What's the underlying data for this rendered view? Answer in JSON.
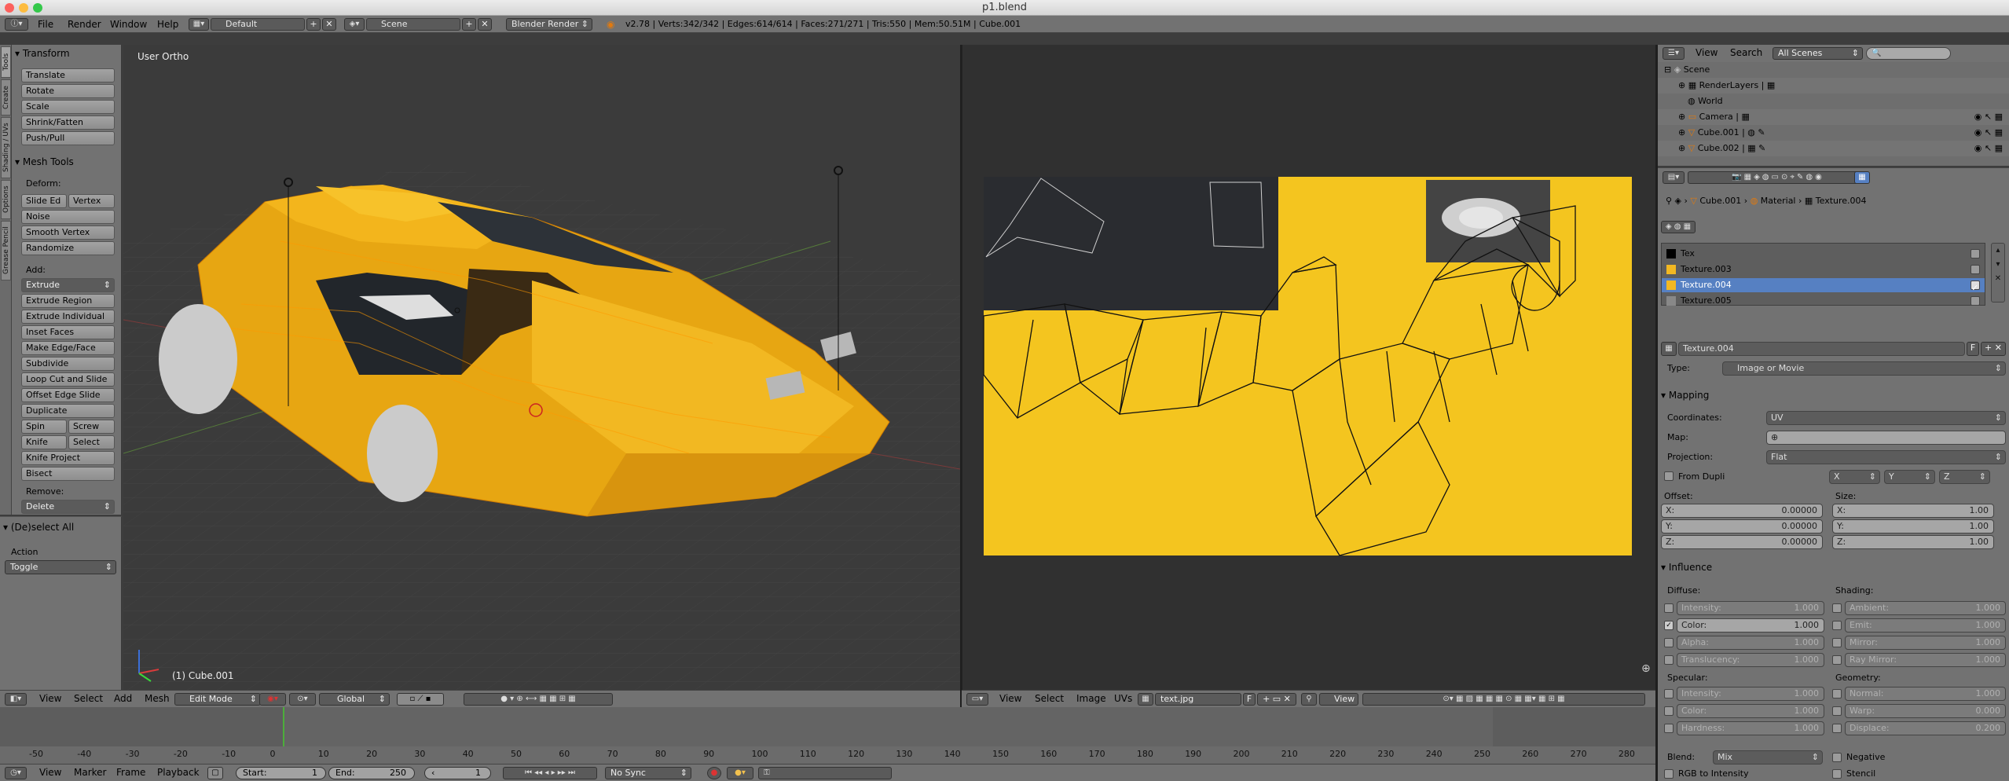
{
  "window": {
    "title": "p1.blend"
  },
  "infobar": {
    "menus": [
      "File",
      "Render",
      "Window",
      "Help"
    ],
    "layout": "Default",
    "scene": "Scene",
    "engine": "Blender Render",
    "stats": "v2.78 | Verts:342/342 | Edges:614/614 | Faces:271/271 | Tris:550 | Mem:50.51M | Cube.001"
  },
  "tool_tabs": [
    "Tools",
    "Create",
    "Shading / UVs",
    "Options",
    "Grease Pencil"
  ],
  "toolshelf": {
    "transform_header": "Transform",
    "transform": [
      "Translate",
      "Rotate",
      "Scale",
      "Shrink/Fatten",
      "Push/Pull"
    ],
    "mesh_tools_header": "Mesh Tools",
    "deform_label": "Deform:",
    "slide_edge": "Slide Ed",
    "vertex": "Vertex",
    "noise": "Noise",
    "smooth_vertex": "Smooth Vertex",
    "randomize": "Randomize",
    "add_label": "Add:",
    "extrude": "Extrude",
    "add_items": [
      "Extrude Region",
      "Extrude Individual",
      "Inset Faces",
      "Make Edge/Face",
      "Subdivide",
      "Loop Cut and Slide",
      "Offset Edge Slide",
      "Duplicate"
    ],
    "spin": "Spin",
    "screw": "Screw",
    "knife": "Knife",
    "select": "Select",
    "knife_project": "Knife Project",
    "bisect": "Bisect",
    "remove_label": "Remove:",
    "delete": "Delete",
    "deselect_header": "(De)select All",
    "action_label": "Action",
    "action_value": "Toggle"
  },
  "viewport": {
    "view_label": "User Ortho",
    "object_label": "(1) Cube.001",
    "header": {
      "menus": [
        "View",
        "Select",
        "Add",
        "Mesh"
      ],
      "mode": "Edit Mode",
      "orientation": "Global"
    }
  },
  "image_editor": {
    "header": {
      "menus": [
        "View",
        "Select",
        "Image",
        "UVs"
      ],
      "image": "text.jpg",
      "view": "View",
      "fake_user": "F"
    }
  },
  "timeline": {
    "ticks": [
      "-50",
      "-40",
      "-30",
      "-20",
      "-10",
      "0",
      "10",
      "20",
      "30",
      "40",
      "50",
      "60",
      "70",
      "80",
      "90",
      "100",
      "110",
      "120",
      "130",
      "140",
      "150",
      "160",
      "170",
      "180",
      "190",
      "200",
      "210",
      "220",
      "230",
      "240",
      "250",
      "260",
      "270",
      "280"
    ],
    "menus": [
      "View",
      "Marker",
      "Frame",
      "Playback"
    ],
    "start_label": "Start:",
    "start": "1",
    "end_label": "End:",
    "end": "250",
    "current": "1",
    "sync": "No Sync"
  },
  "outliner": {
    "menus": [
      "View",
      "Search"
    ],
    "filter": "All Scenes",
    "items": [
      "Scene",
      "RenderLayers",
      "World",
      "Camera",
      "Cube.001",
      "Cube.002"
    ]
  },
  "properties": {
    "breadcrumb": [
      "Cube.001",
      "Material",
      "Texture.004"
    ],
    "texture_slots": [
      "Tex",
      "Texture.003",
      "Texture.004",
      "Texture.005"
    ],
    "texture_name": "Texture.004",
    "fake_user": "F",
    "type_label": "Type:",
    "type_value": "Image or Movie",
    "mapping_header": "Mapping",
    "coordinates_label": "Coordinates:",
    "coordinates_value": "UV",
    "map_label": "Map:",
    "projection_label": "Projection:",
    "projection_value": "Flat",
    "from_dupli": "From Dupli",
    "proj_axes": [
      "X",
      "Y",
      "Z"
    ],
    "offset_label": "Offset:",
    "size_label": "Size:",
    "offset": [
      {
        "axis": "X:",
        "value": "0.00000"
      },
      {
        "axis": "Y:",
        "value": "0.00000"
      },
      {
        "axis": "Z:",
        "value": "0.00000"
      }
    ],
    "size": [
      {
        "axis": "X:",
        "value": "1.00"
      },
      {
        "axis": "Y:",
        "value": "1.00"
      },
      {
        "axis": "Z:",
        "value": "1.00"
      }
    ],
    "influence_header": "Influence",
    "diffuse_label": "Diffuse:",
    "shading_label": "Shading:",
    "diffuse": [
      {
        "name": "Intensity:",
        "value": "1.000"
      },
      {
        "name": "Color:",
        "value": "1.000"
      },
      {
        "name": "Alpha:",
        "value": "1.000"
      },
      {
        "name": "Translucency:",
        "value": "1.000"
      }
    ],
    "shading": [
      {
        "name": "Ambient:",
        "value": "1.000"
      },
      {
        "name": "Emit:",
        "value": "1.000"
      },
      {
        "name": "Mirror:",
        "value": "1.000"
      },
      {
        "name": "Ray Mirror:",
        "value": "1.000"
      }
    ],
    "specular_label": "Specular:",
    "geometry_label": "Geometry:",
    "specular": [
      {
        "name": "Intensity:",
        "value": "1.000"
      },
      {
        "name": "Color:",
        "value": "1.000"
      },
      {
        "name": "Hardness:",
        "value": "1.000"
      }
    ],
    "geometry": [
      {
        "name": "Normal:",
        "value": "1.000"
      },
      {
        "name": "Warp:",
        "value": "0.000"
      },
      {
        "name": "Displace:",
        "value": "0.200"
      }
    ],
    "blend_label": "Blend:",
    "blend_value": "Mix",
    "negative": "Negative",
    "rgb_to_intensity": "RGB to Intensity",
    "stencil": "Stencil"
  },
  "colors": {
    "accent_blue": "#5680c2",
    "car_yellow": "#f1b21b",
    "uv_yellow": "#f4c51f"
  }
}
